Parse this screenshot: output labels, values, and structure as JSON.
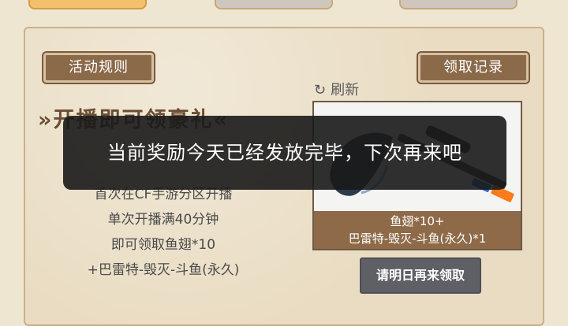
{
  "header": {
    "tabs": [
      {
        "active": true
      },
      {
        "active": false
      },
      {
        "active": false
      }
    ]
  },
  "panel": {
    "rules_label": "活动规则",
    "record_label": "领取记录",
    "title": "»开播即可领豪礼«",
    "lines": [
      "首次在CF手游分区开播",
      "单次开播满40分钟",
      "即可领取鱼翅*10",
      "+巴雷特-毁灭-斗鱼(永久)"
    ],
    "refresh_label": "刷新",
    "prize": {
      "line1": "鱼翅*10+",
      "line2": "巴雷特-毁灭-斗鱼(永久)*1"
    },
    "claim_label": "请明日再来领取"
  },
  "toast": {
    "message": "当前奖励今天已经发放完毕，下次再来吧"
  },
  "colors": {
    "accent": "#d98a14",
    "panel_bg": "#e9dcc2",
    "button_brown": "#8b6a4a",
    "disabled_button": "#5f5f66"
  }
}
